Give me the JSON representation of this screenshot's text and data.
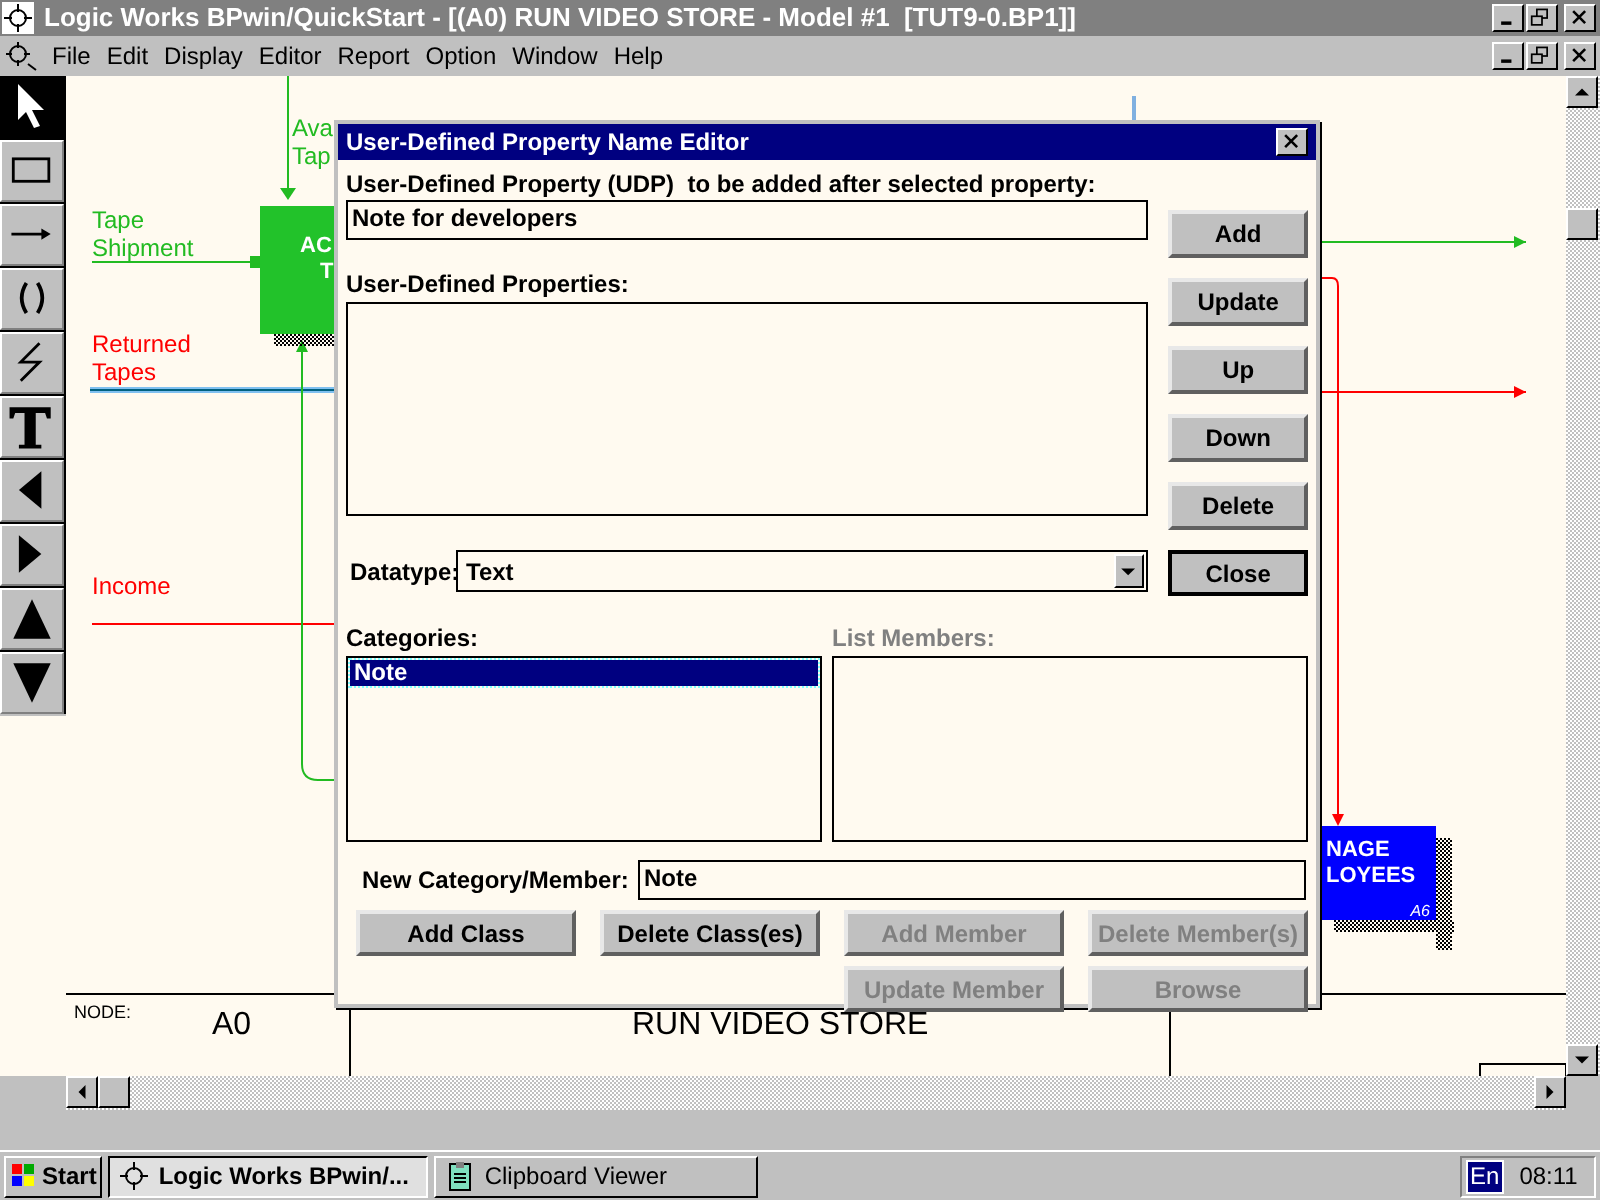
{
  "window": {
    "title": "Logic Works BPwin/QuickStart - [(A0) RUN VIDEO STORE - Model #1  [TUT9-0.BP1]]"
  },
  "menu": [
    "File",
    "Edit",
    "Display",
    "Editor",
    "Report",
    "Option",
    "Window",
    "Help"
  ],
  "toolbox": [
    {
      "kind": "pointer",
      "selected": true
    },
    {
      "kind": "box",
      "selected": false
    },
    {
      "kind": "arrow",
      "selected": false
    },
    {
      "kind": "tunnel",
      "selected": false
    },
    {
      "kind": "squiggle",
      "selected": false
    },
    {
      "kind": "text",
      "selected": false
    },
    {
      "kind": "left",
      "selected": false
    },
    {
      "kind": "right",
      "selected": false
    },
    {
      "kind": "up",
      "selected": false
    },
    {
      "kind": "down",
      "selected": false
    }
  ],
  "diagram": {
    "arrow_labels": [
      {
        "lines": [
          "Ava",
          "Tap"
        ],
        "color": "#22bb22"
      },
      {
        "lines": [
          "Tape",
          "Shipment"
        ],
        "color": "#22bb22"
      },
      {
        "lines": [
          "Returned",
          "Tapes"
        ],
        "color": "#ff0000"
      },
      {
        "lines": [
          "Income"
        ],
        "color": "#ff0000"
      }
    ],
    "boxes": [
      {
        "lines": [
          "AC",
          "T"
        ],
        "color": "#22c22a"
      },
      {
        "lines": [
          "NAGE",
          "LOYEES"
        ],
        "number": "A6",
        "color": "#0000ff"
      }
    ],
    "frame": {
      "node_label": "NODE:",
      "node": "A0",
      "title": "RUN VIDEO STORE"
    }
  },
  "dialog": {
    "title": "User-Defined Property Name Editor",
    "udp_label": "User-Defined Property (UDP)  to be added after selected property:",
    "udp_value": "Note for developers",
    "properties_label": "User-Defined Properties:",
    "datatype_label": "Datatype:",
    "datatype_value": "Text",
    "side_buttons": [
      {
        "label": "Add",
        "default": false
      },
      {
        "label": "Update",
        "default": false
      },
      {
        "label": "Up",
        "default": false
      },
      {
        "label": "Down",
        "default": false
      },
      {
        "label": "Delete",
        "default": false
      },
      {
        "label": "Close",
        "default": true
      }
    ],
    "categories_label": "Categories:",
    "categories": [
      {
        "text": "Note",
        "selected": true
      }
    ],
    "members_label": "List Members:",
    "members_disabled": true,
    "new_label": "New Category/Member:",
    "new_value": "Note",
    "buttons": [
      {
        "label": "Add Class",
        "disabled": false
      },
      {
        "label": "Delete Class(es)",
        "disabled": false
      },
      {
        "label": "Add Member",
        "disabled": true
      },
      {
        "label": "Delete Member(s)",
        "disabled": true
      },
      {
        "label": "Update Member",
        "disabled": true
      },
      {
        "label": "Browse",
        "disabled": true
      }
    ]
  },
  "taskbar": {
    "start": "Start",
    "tasks": [
      {
        "label": "Logic Works BPwin/...",
        "selected": true,
        "kind": "app"
      },
      {
        "label": "Clipboard Viewer",
        "selected": false,
        "kind": "clipboard"
      }
    ],
    "language": "En",
    "clock": "08:11"
  }
}
